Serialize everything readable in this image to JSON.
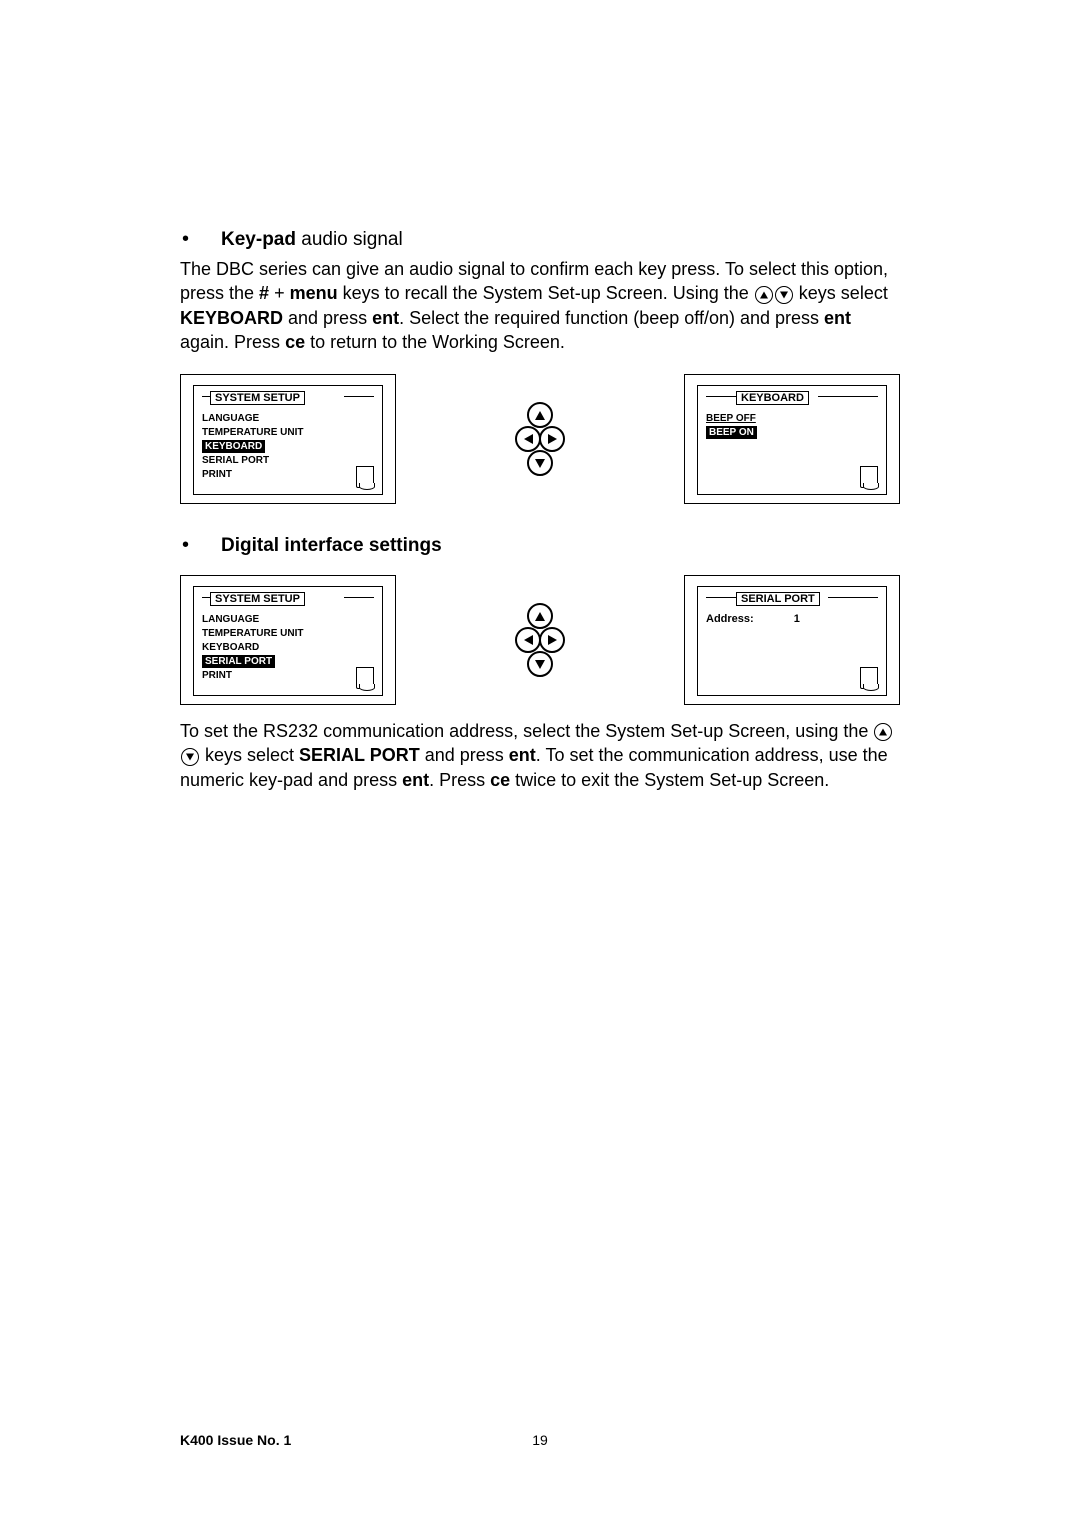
{
  "section1": {
    "bullet_title_bold": "Key-pad",
    "bullet_title_rest": " audio signal",
    "paragraph_parts": {
      "p1": "The DBC series can give an audio signal to confirm each key press. To select this option, press the ",
      "p2": "#",
      "p3": " + ",
      "p4": "menu",
      "p5": " keys to recall the System Set-up Screen. Using the ",
      "p6": " keys select ",
      "p7": "KEYBOARD",
      "p8": " and press ",
      "p9": "ent",
      "p10": ". Select the required function (beep off/on) and press ",
      "p11": "ent",
      "p12": " again. Press ",
      "p13": "ce",
      "p14": " to return to the Working Screen."
    },
    "screen1": {
      "title": "SYSTEM SETUP",
      "items": [
        "LANGUAGE",
        "TEMPERATURE UNIT",
        "KEYBOARD",
        "SERIAL PORT",
        "PRINT"
      ],
      "selected_index": 2
    },
    "screen2": {
      "title": "KEYBOARD",
      "items": [
        "BEEP OFF",
        "BEEP ON"
      ],
      "selected_index": 1
    }
  },
  "section2": {
    "bullet_title": "Digital interface settings",
    "screen1": {
      "title": "SYSTEM SETUP",
      "items": [
        "LANGUAGE",
        "TEMPERATURE UNIT",
        "KEYBOARD",
        "SERIAL PORT",
        "PRINT"
      ],
      "selected_index": 3
    },
    "screen2": {
      "title": "SERIAL PORT",
      "address_label": "Address:",
      "address_value": "1"
    },
    "paragraph_parts": {
      "p1": "To set the RS232 communication address, select the System Set-up Screen, using the ",
      "p2": " keys select ",
      "p3": "SERIAL PORT",
      "p4": " and press ",
      "p5": "ent",
      "p6": ". To set the communication address, use the numeric key-pad and press ",
      "p7": "ent",
      "p8": ". Press ",
      "p9": "ce",
      "p10": " twice to exit the System Set-up Screen."
    }
  },
  "footer": {
    "left": "K400 Issue No. 1",
    "page": "19"
  }
}
